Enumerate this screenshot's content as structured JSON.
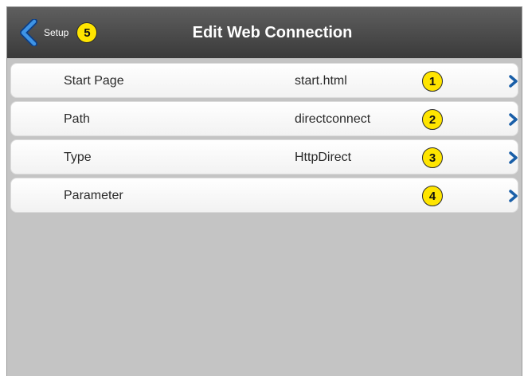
{
  "header": {
    "back_label": "Setup",
    "back_badge": "5",
    "title": "Edit Web Connection"
  },
  "rows": [
    {
      "label": "Start Page",
      "value": "start.html",
      "badge": "1"
    },
    {
      "label": "Path",
      "value": "directconnect",
      "badge": "2"
    },
    {
      "label": "Type",
      "value": "HttpDirect",
      "badge": "3"
    },
    {
      "label": "Parameter",
      "value": "",
      "badge": "4"
    }
  ],
  "colors": {
    "header_bg": "#3a3a3a",
    "body_bg": "#c4c4c4",
    "accent": "#1f6fc4",
    "badge": "#ffe500"
  },
  "icons": {
    "back": "chevron-left-icon",
    "row": "chevron-right-icon"
  }
}
